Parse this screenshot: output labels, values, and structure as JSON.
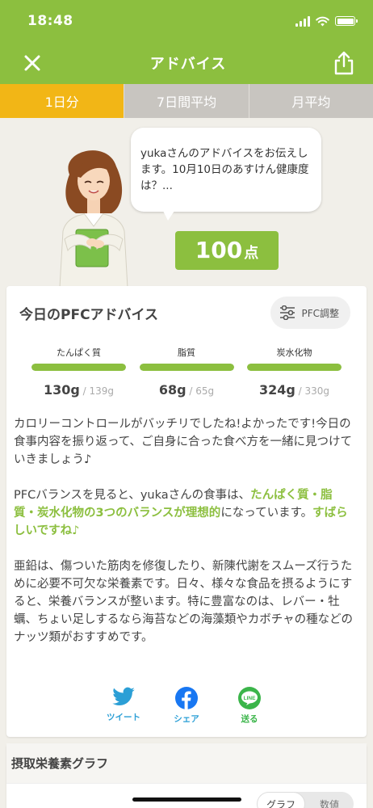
{
  "status": {
    "time": "18:48"
  },
  "nav": {
    "title": "アドバイス"
  },
  "tabs": [
    {
      "label": "1日分",
      "active": true
    },
    {
      "label": "7日間平均",
      "active": false
    },
    {
      "label": "月平均",
      "active": false
    }
  ],
  "advisor": {
    "message": "yukaさんのアドバイスをお伝えします。10月10日のあすけん健康度は？...",
    "score": "100",
    "score_unit": "点"
  },
  "pfc": {
    "title": "今日のPFCアドバイス",
    "adjust_label": "PFC調整",
    "items": [
      {
        "label": "たんぱく質",
        "value": "130g",
        "target": " / 139g",
        "fill": 1.0
      },
      {
        "label": "脂質",
        "value": "68g",
        "target": " / 65g",
        "fill": 1.0
      },
      {
        "label": "炭水化物",
        "value": "324g",
        "target": " / 330g",
        "fill": 1.0
      }
    ],
    "advice_p1": "カロリーコントロールがバッチリでしたね!よかったです!今日の食事内容を振り返って、ご自身に合った食べ方を一緒に見つけていきましょう♪",
    "advice_p2_a": "PFCバランスを見ると、yukaさんの食事は、",
    "advice_p2_hl1": "たんぱく質・脂質・炭水化物の3つのバランスが理想的",
    "advice_p2_b": "になっています。",
    "advice_p2_hl2": "すばらしいですね♪",
    "advice_p3": "亜鉛は、傷ついた筋肉を修復したり、新陳代謝をスムーズ行うために必要不可欠な栄養素です。日々、様々な食品を摂るようにすると、栄養バランスが整います。特に豊富なのは、レバー・牡蠣、ちょい足しするなら海苔などの海藻類やカボチャの種などのナッツ類がおすすめです。",
    "share": [
      {
        "label": "ツイート",
        "icon": "twitter-icon"
      },
      {
        "label": "シェア",
        "icon": "facebook-icon"
      },
      {
        "label": "送る",
        "icon": "line-icon"
      }
    ]
  },
  "graph": {
    "title": "摂取栄養素グラフ",
    "toggle": [
      "グラフ",
      "数値"
    ]
  },
  "colors": {
    "brand_green": "#8cbf3f",
    "tab_active": "#f2b616",
    "tab_inactive": "#c8c5c0"
  }
}
